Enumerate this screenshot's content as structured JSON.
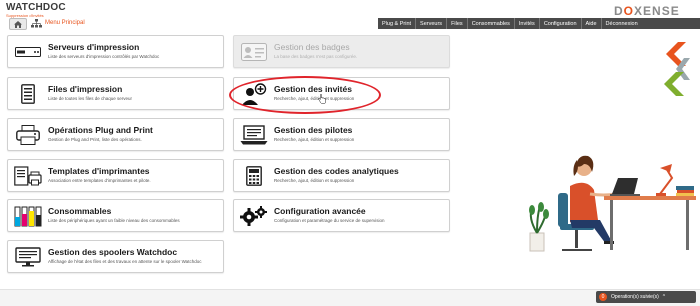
{
  "header": {
    "logo_text": "WATCHDOC",
    "logo_subtitle": "Suppression d'invités",
    "brand_prefix": "D",
    "brand_o": "O",
    "brand_suffix": "XENSE",
    "menu_label": "Menu Principal"
  },
  "nav": [
    {
      "label": "Plug & Print"
    },
    {
      "label": "Serveurs"
    },
    {
      "label": "Files"
    },
    {
      "label": "Consommables"
    },
    {
      "label": "Invités"
    },
    {
      "label": "Configuration"
    },
    {
      "label": "Aide"
    },
    {
      "label": "Déconnexion"
    }
  ],
  "tiles": {
    "servers": {
      "title": "Serveurs d'impression",
      "desc": "Liste des serveurs d'impression contrôlés par Watchdoc",
      "icon": "server-icon"
    },
    "badges": {
      "title": "Gestion des badges",
      "desc": "La base des badges n'est pas configurée.",
      "icon": "badge-icon",
      "disabled": true
    },
    "queues": {
      "title": "Files d'impression",
      "desc": "Liste de toutes les files de chaque serveur",
      "icon": "print-queue-icon"
    },
    "guests": {
      "title": "Gestion des invités",
      "desc": "Recherche, ajout, édition et suppression",
      "icon": "add-guest-icon"
    },
    "plugprint": {
      "title": "Opérations Plug and Print",
      "desc": "Gestion de Plug and Print, liste des opérations.",
      "icon": "printer-icon"
    },
    "drivers": {
      "title": "Gestion des pilotes",
      "desc": "Recherche, ajout, édition et suppression",
      "icon": "laptop-driver-icon"
    },
    "templates": {
      "title": "Templates d'imprimantes",
      "desc": "Association entre templates d'imprimantes et pilote.",
      "icon": "printer-template-icon"
    },
    "analytics": {
      "title": "Gestion des codes analytiques",
      "desc": "Recherche, ajout, édition et suppression",
      "icon": "calculator-icon"
    },
    "consumables": {
      "title": "Consommables",
      "desc": "Liste des périphériques ayant un faible niveau des consommables",
      "icon": "ink-cartridges-icon"
    },
    "advanced": {
      "title": "Configuration avancée",
      "desc": "Configuration et paramétrage du service de supervision",
      "icon": "gears-icon"
    },
    "spoolers": {
      "title": "Gestion des spoolers Watchdoc",
      "desc": "Affichage de l'état des files et des travaux en attente sur le spooler Watchdoc",
      "icon": "monitor-spooler-icon"
    }
  },
  "status": {
    "count": "0",
    "label": "Operation(s) suivie(s)",
    "caret": "^"
  },
  "colors": {
    "accent": "#e8541e",
    "navbar": "#4a4a4a",
    "highlight": "#e0242b"
  }
}
